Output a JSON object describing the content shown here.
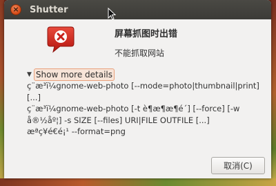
{
  "window": {
    "title": "Shutter",
    "close_symbol": "×"
  },
  "dialog": {
    "icon": "error-speech-bubble-icon",
    "heading": "屏幕抓图时出错",
    "subheading": "不能抓取网站",
    "expander_arrow": "▼",
    "expander_label": "Show more details",
    "details_lines": [
      "ç¨æ³ï¼gnome-web-photo [--mode=photo|thumbnail|print] [...]",
      "ç¨æ³ï¼gnome-web-photo [-t è¶æ¶æ¶é´] [--force] [-w å®½åº¦] -s SIZE [--files] URI|FILE OUTFILE [...]",
      "æªç¥é€é¡¹ --format=png"
    ],
    "cancel_label": "取消(C)"
  },
  "colors": {
    "titlebar": "#3c3b37",
    "dialog_bg": "#f2f1f0",
    "close_button": "#d34613",
    "error_icon": "#c7201b",
    "expander_highlight": "#e9a07a"
  }
}
